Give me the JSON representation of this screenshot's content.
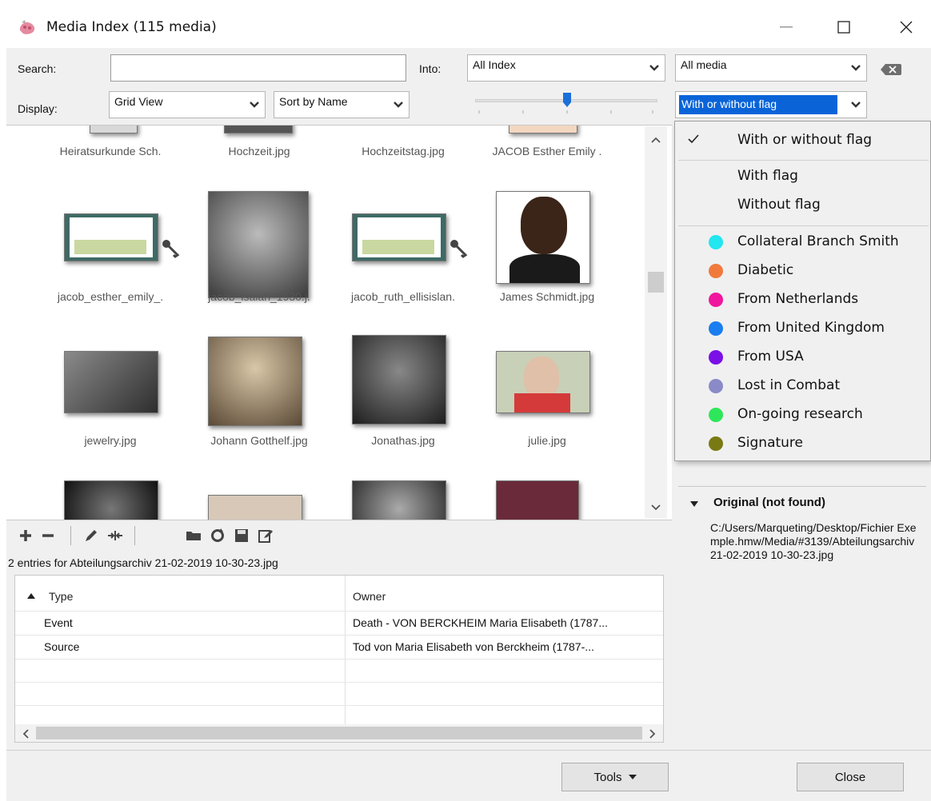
{
  "window": {
    "title": "Media Index (115 media)"
  },
  "filters": {
    "search_label": "Search:",
    "search_value": "",
    "into_label": "Into:",
    "into_value": "All Index",
    "media_value": "All media",
    "display_label": "Display:",
    "display_value": "Grid View",
    "sort_value": "Sort by Name",
    "flag_value": "With or without flag"
  },
  "grid": {
    "rows": [
      [
        "Heiratsurkunde Sch.",
        "Hochzeit.jpg",
        "Hochzeitstag.jpg",
        "JACOB Esther Emily ."
      ],
      [
        "jacob_esther_emily_.",
        "jacob_isaiah_1930.j.",
        "jacob_ruth_ellisislan.",
        "James Schmidt.jpg"
      ],
      [
        "jewelry.jpg",
        "Johann Gotthelf.jpg",
        "Jonathas.jpg",
        "julie.jpg"
      ]
    ]
  },
  "usage": {
    "summary": "2 entries for Abteilungsarchiv 21-02-2019 10-30-23.jpg",
    "columns": [
      "Type",
      "Owner"
    ],
    "rows": [
      {
        "type": "Event",
        "owner": "Death - VON BERCKHEIM Maria Elisabeth (1787..."
      },
      {
        "type": "Source",
        "owner": "Tod von Maria Elisabeth von Berckheim (1787-..."
      }
    ]
  },
  "flag_menu": {
    "items": [
      {
        "label": "With or without flag",
        "checked": true
      },
      {
        "label": "With flag"
      },
      {
        "label": "Without flag"
      }
    ],
    "flags": [
      {
        "label": "Collateral Branch Smith",
        "color": "#22e6f0"
      },
      {
        "label": "Diabetic",
        "color": "#f07a3c"
      },
      {
        "label": "From Netherlands",
        "color": "#f0169e"
      },
      {
        "label": "From United Kingdom",
        "color": "#1a7ef0"
      },
      {
        "label": "From USA",
        "color": "#7a10e6"
      },
      {
        "label": "Lost in Combat",
        "color": "#8a8ac8"
      },
      {
        "label": "On-going research",
        "color": "#2ee65a"
      },
      {
        "label": "Signature",
        "color": "#7a7a14"
      }
    ]
  },
  "details": {
    "heading": "Original (not found)",
    "path": "C:/Users/Marqueting/Desktop/Fichier Exemple.hmw/Media/#3139/Abteilungsarchiv 21-02-2019 10-30-23.jpg"
  },
  "buttons": {
    "tools": "Tools",
    "close": "Close"
  }
}
